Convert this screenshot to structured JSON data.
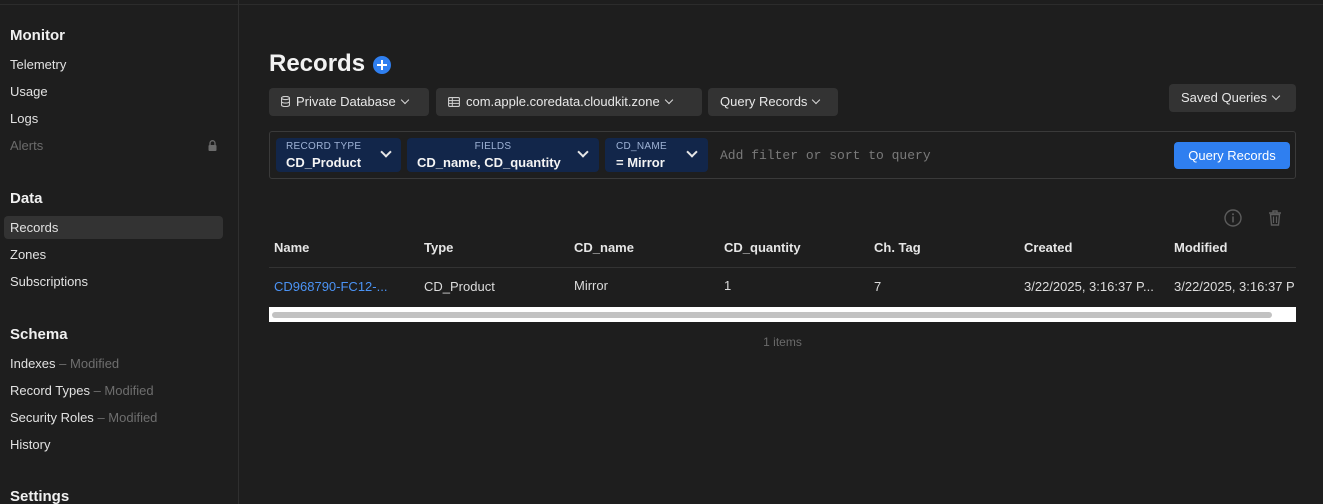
{
  "sidebar": {
    "monitor": {
      "title": "Monitor",
      "items": [
        "Telemetry",
        "Usage",
        "Logs",
        "Alerts"
      ]
    },
    "data": {
      "title": "Data",
      "items": [
        "Records",
        "Zones",
        "Subscriptions"
      ]
    },
    "schema": {
      "title": "Schema",
      "items": [
        {
          "label": "Indexes",
          "status": "– Modified"
        },
        {
          "label": "Record Types",
          "status": "– Modified"
        },
        {
          "label": "Security Roles",
          "status": "– Modified"
        },
        {
          "label": "History",
          "status": ""
        }
      ]
    },
    "settings": {
      "title": "Settings"
    }
  },
  "page": {
    "title": "Records"
  },
  "toolbar": {
    "database": "Private Database",
    "zone": "com.apple.coredata.cloudkit.zone",
    "query_type": "Query Records",
    "saved_queries": "Saved Queries"
  },
  "filter": {
    "chips": [
      {
        "key": "RECORD TYPE",
        "value": "CD_Product"
      },
      {
        "key": "FIELDS",
        "value": "CD_name, CD_quantity"
      },
      {
        "key": "CD_NAME",
        "value": "= Mirror"
      }
    ],
    "placeholder": "Add filter or sort to query",
    "button": "Query Records"
  },
  "table": {
    "columns": [
      "Name",
      "Type",
      "CD_name",
      "CD_quantity",
      "Ch. Tag",
      "Created",
      "Modified"
    ],
    "rows": [
      [
        "CD968790-FC12-...",
        "CD_Product",
        "Mirror",
        "1",
        "7",
        "3/22/2025, 3:16:37 P...",
        "3/22/2025, 3:16:37 P"
      ]
    ],
    "count": "1 items"
  },
  "colors": {
    "accent": "#2f7ff0",
    "link": "#4b93f5",
    "chip": "#12264a",
    "background": "#1e1e1e"
  },
  "icons": [
    "lock-icon",
    "plus-icon",
    "database-icon",
    "table-icon",
    "chevron-down-icon",
    "info-icon",
    "trash-icon"
  ]
}
